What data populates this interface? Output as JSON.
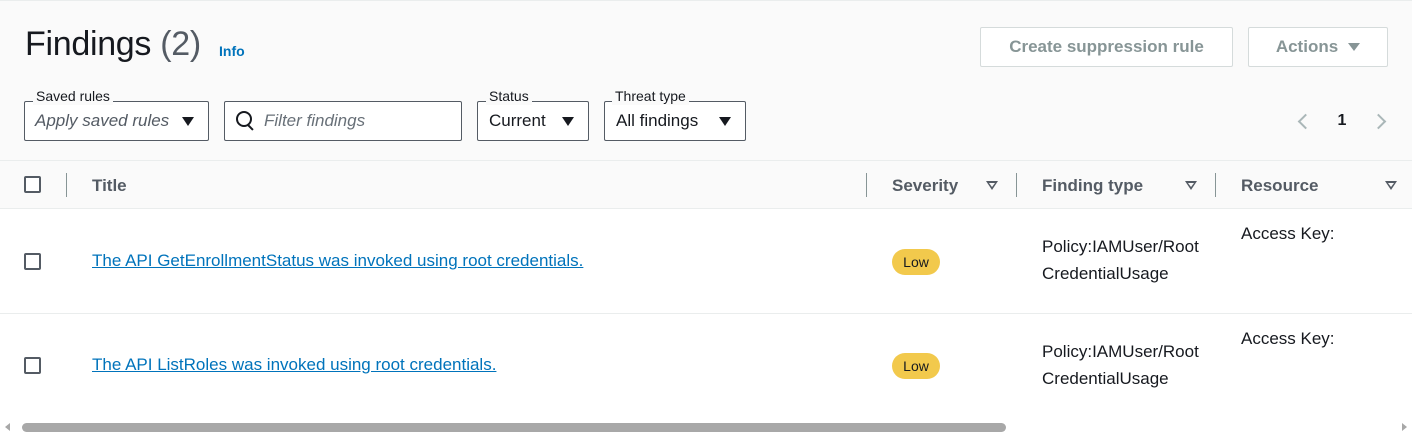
{
  "header": {
    "title": "Findings",
    "count": "(2)",
    "info_label": "Info",
    "suppress_button": "Create suppression rule",
    "actions_button": "Actions"
  },
  "filters": {
    "saved_rules_label": "Saved rules",
    "saved_rules_value": "Apply saved rules",
    "search_placeholder": "Filter findings",
    "status_label": "Status",
    "status_value": "Current",
    "threat_label": "Threat type",
    "threat_value": "All findings"
  },
  "pagination": {
    "current_page": "1"
  },
  "table": {
    "columns": [
      "Title",
      "Severity",
      "Finding type",
      "Resource"
    ],
    "rows": [
      {
        "title": "The API GetEnrollmentStatus was invoked using root credentials.",
        "severity": "Low",
        "finding_type": "Policy:IAMUser/RootCredentialUsage",
        "resource": "Access Key:"
      },
      {
        "title": "The API ListRoles was invoked using root credentials.",
        "severity": "Low",
        "finding_type": "Policy:IAMUser/RootCredentialUsage",
        "resource": "Access Key:"
      }
    ]
  },
  "colors": {
    "link": "#0073bb",
    "badge_low": "#f2c94c",
    "header_bg": "#fafafa"
  }
}
